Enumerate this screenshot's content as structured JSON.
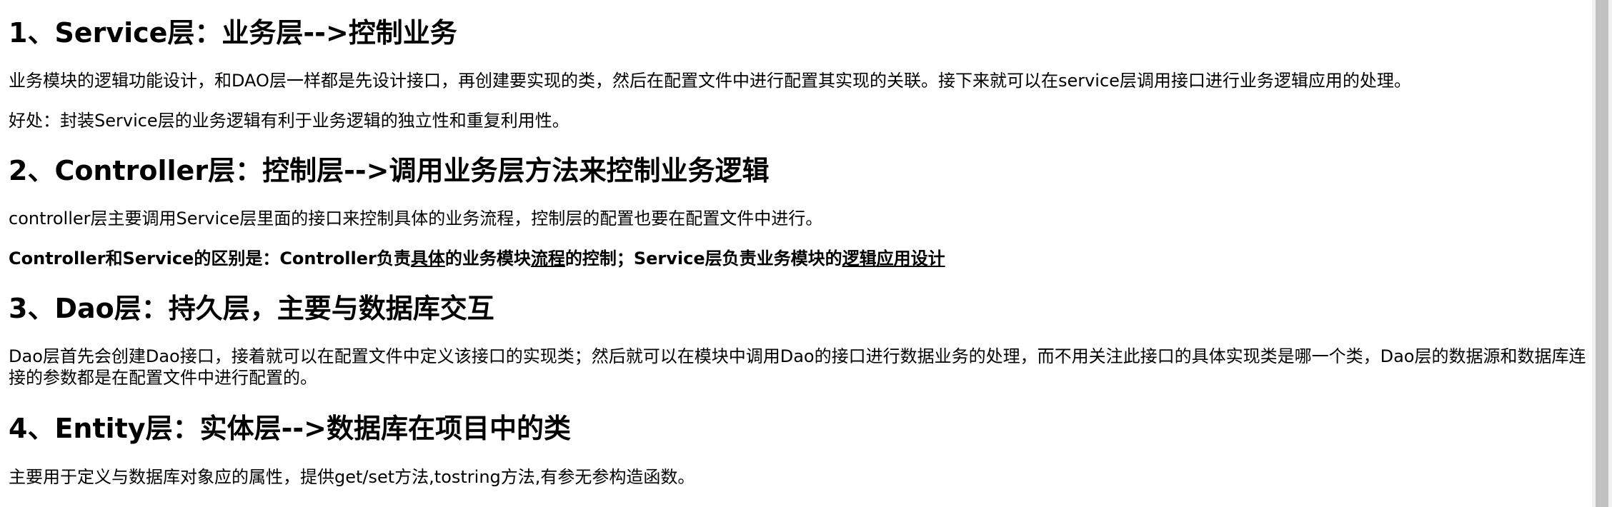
{
  "sections": [
    {
      "heading": "1、Service层：业务层-->控制业务",
      "paragraphs": [
        "业务模块的逻辑功能设计，和DAO层一样都是先设计接口，再创建要实现的类，然后在配置文件中进行配置其实现的关联。接下来就可以在service层调用接口进行业务逻辑应用的处理。",
        "好处：封装Service层的业务逻辑有利于业务逻辑的独立性和重复利用性。"
      ]
    },
    {
      "heading": "2、Controller层：控制层-->调用业务层方法来控制业务逻辑",
      "paragraphs": [
        "controller层主要调用Service层里面的接口来控制具体的业务流程，控制层的配置也要在配置文件中进行。"
      ],
      "bold_paragraph": {
        "part1": "Controller和Service的区别是：Controller负责",
        "part2_underlined": "具体",
        "part3": "的业务模块",
        "part4_underlined": "流程",
        "part5": "的控制；Service层负责业务模块的",
        "part6_underlined": "逻辑应用设计"
      }
    },
    {
      "heading": "3、Dao层：持久层，主要与数据库交互",
      "paragraphs": [
        "Dao层首先会创建Dao接口，接着就可以在配置文件中定义该接口的实现类；然后就可以在模块中调用Dao的接口进行数据业务的处理，而不用关注此接口的具体实现类是哪一个类，Dao层的数据源和数据库连接的参数都是在配置文件中进行配置的。"
      ]
    },
    {
      "heading": "4、Entity层：实体层-->数据库在项目中的类",
      "paragraphs": [
        "主要用于定义与数据库对象应的属性，提供get/set方法,tostring方法,有参无参构造函数。"
      ]
    }
  ]
}
